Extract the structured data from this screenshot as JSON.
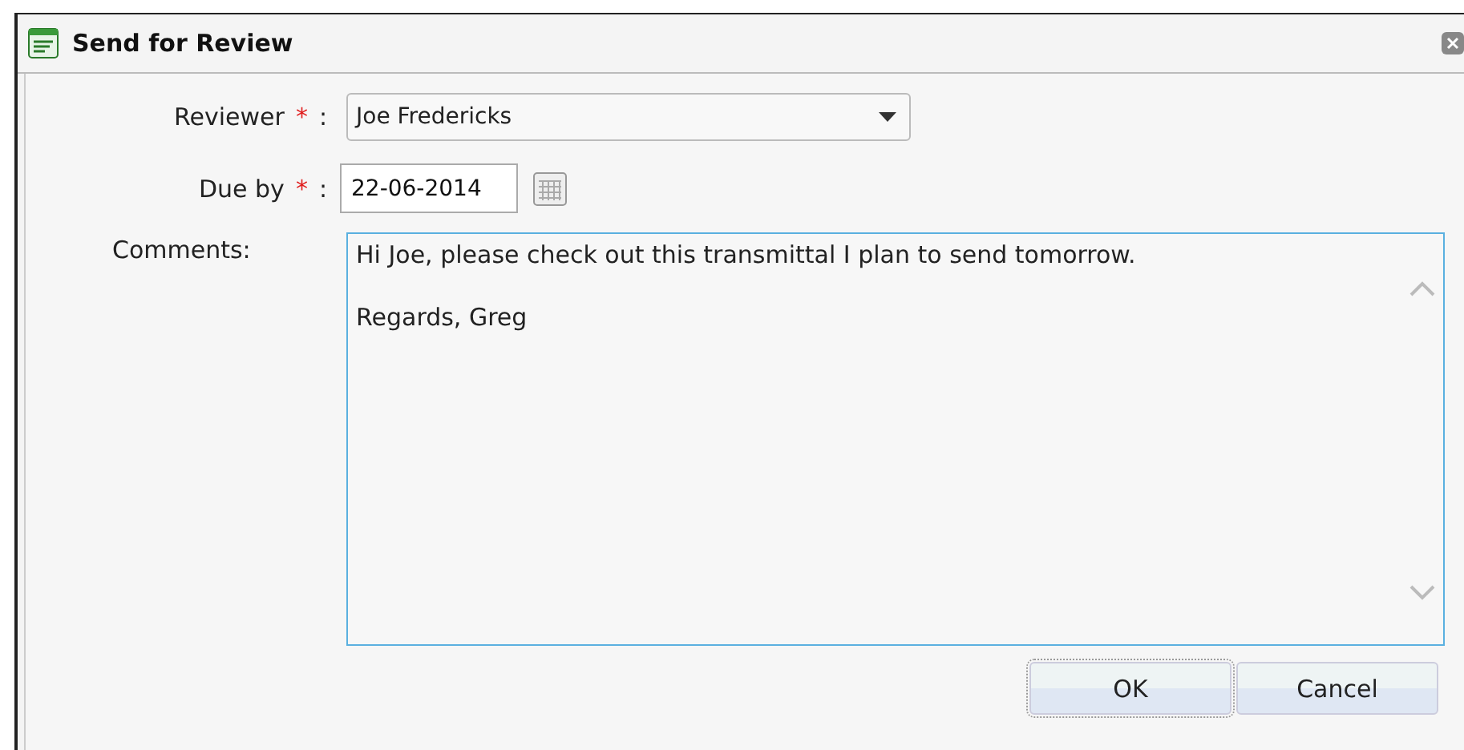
{
  "window": {
    "title": "Send for Review"
  },
  "fields": [
    {
      "label": "Reviewer",
      "required_mark": "*",
      "separator": ":",
      "kind": "dropdown",
      "value": "Joe Fredericks"
    },
    {
      "label": "Due by",
      "required_mark": "*",
      "separator": ":",
      "kind": "date",
      "value": "22-06-2014"
    }
  ],
  "comments": {
    "label": "Comments:",
    "value": "Hi Joe, please check out this transmittal I plan to send tomorrow.\n\nRegards, Greg",
    "focused": true
  },
  "buttons": [
    {
      "label": "OK",
      "focused": true
    },
    {
      "label": "Cancel",
      "focused": false
    }
  ]
}
